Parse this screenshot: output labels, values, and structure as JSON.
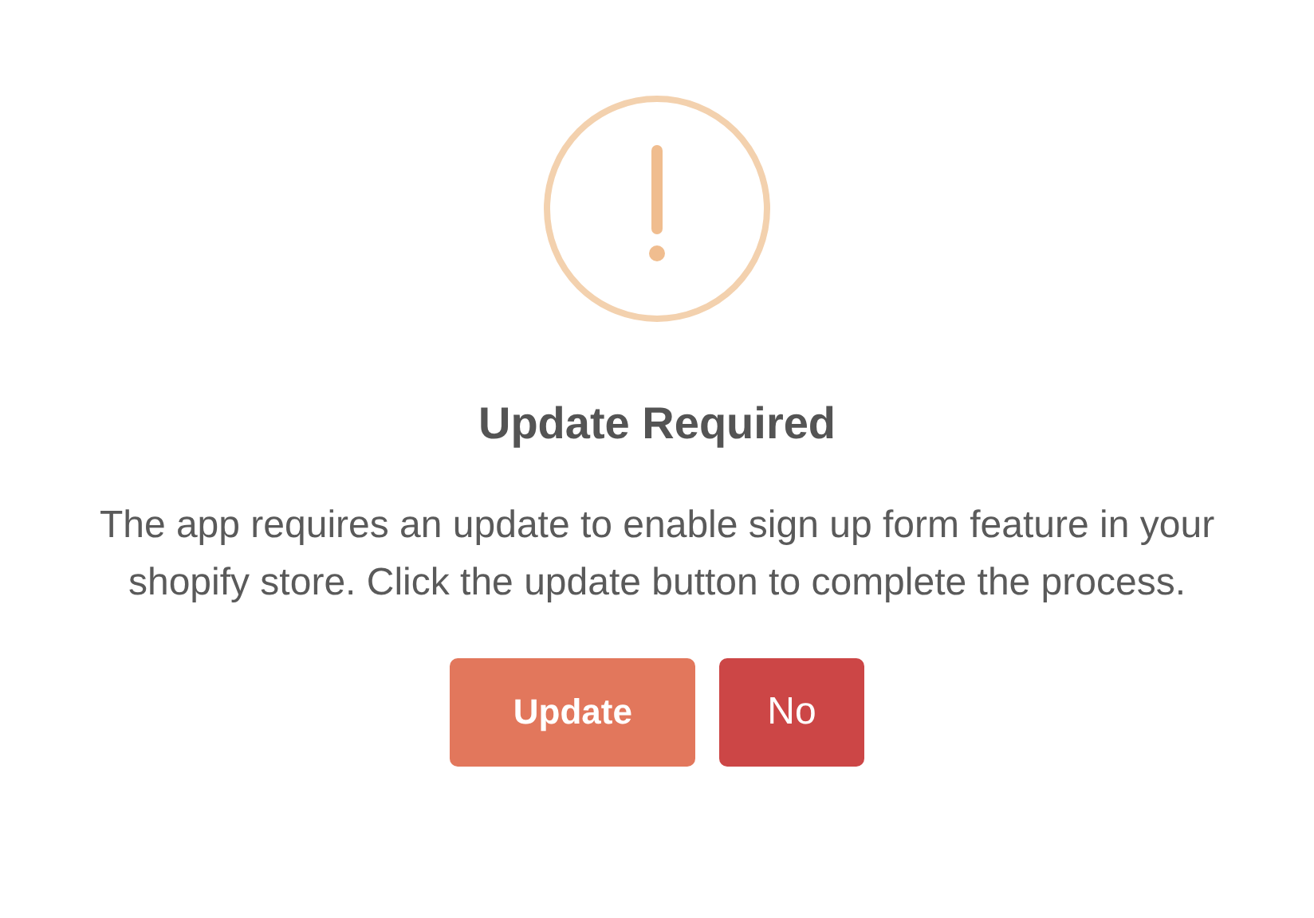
{
  "dialog": {
    "title": "Update Required",
    "message": "The app requires an update to enable sign up form feature in your shopify store. Click the update button to complete the process.",
    "buttons": [
      {
        "label": "Update",
        "kind": "confirm"
      },
      {
        "label": "No",
        "kind": "cancel"
      }
    ]
  }
}
